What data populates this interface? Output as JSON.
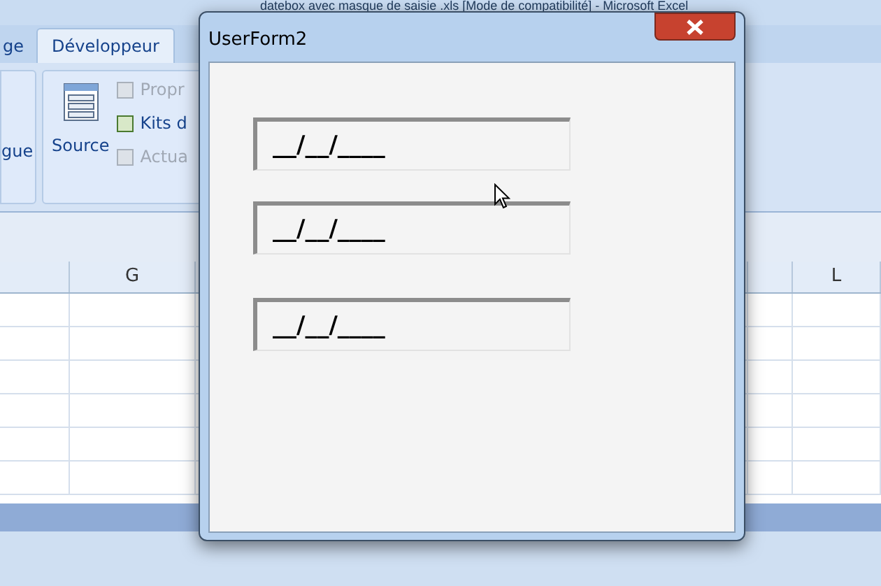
{
  "app_title": "datebox avec masque de saisie .xls [Mode de compatibilité] - Microsoft Excel",
  "ribbon": {
    "tabs": [
      {
        "label": "ge",
        "selected": false
      },
      {
        "label": "Développeur",
        "selected": true
      }
    ],
    "left_group_label": "gue",
    "source_button": "Source",
    "commands": [
      {
        "label": "Propr",
        "disabled": true
      },
      {
        "label": "Kits d",
        "disabled": false
      },
      {
        "label": "Actua",
        "disabled": true
      }
    ]
  },
  "sheet": {
    "columns": [
      "G",
      "L"
    ]
  },
  "dialog": {
    "title": "UserForm2",
    "fields": [
      {
        "value": "__/__/____"
      },
      {
        "value": "__/__/____"
      },
      {
        "value": "__/__/____"
      }
    ]
  }
}
